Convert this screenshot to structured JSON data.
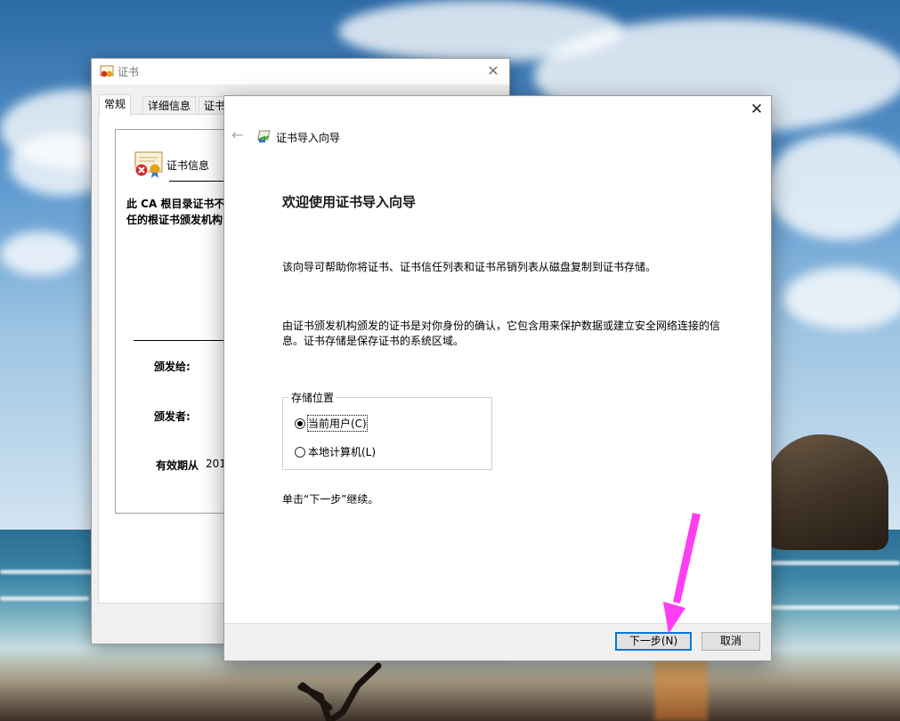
{
  "desktop": {
    "accent": "#0078d7",
    "annotation_color": "#ff3df2"
  },
  "cert_window": {
    "title": "证书",
    "tabs": [
      "常规",
      "详细信息",
      "证书"
    ],
    "info_title": "证书信息",
    "info_text_line1": "此 CA 根目录证书不",
    "info_text_line2": "任的根证书颁发机构",
    "issued_to_label": "颁发给:",
    "issued_by_label": "颁发者:",
    "valid_from_label": "有效期从",
    "valid_from_value": "201"
  },
  "wizard": {
    "title": "证书导入向导",
    "heading": "欢迎使用证书导入向导",
    "paragraph1": "该向导可帮助你将证书、证书信任列表和证书吊销列表从磁盘复制到证书存储。",
    "paragraph2_line1": "由证书颁发机构颁发的证书是对你身份的确认，它包含用来保护数据或建立安全网络连接的信",
    "paragraph2_line2": "息。证书存储是保存证书的系统区域。",
    "store_location": {
      "legend": "存储位置",
      "options": [
        {
          "label": "当前用户(C)",
          "checked": true
        },
        {
          "label": "本地计算机(L)",
          "checked": false
        }
      ]
    },
    "continue_hint": "单击“下一步”继续。",
    "buttons": {
      "next": "下一步(N)",
      "cancel": "取消"
    }
  }
}
